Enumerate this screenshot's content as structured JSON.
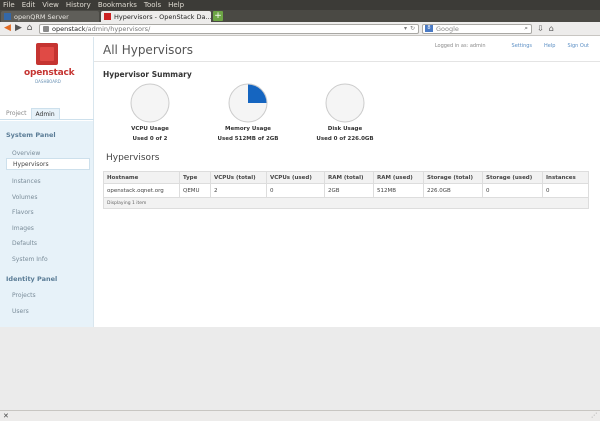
{
  "browser": {
    "menu": [
      "File",
      "Edit",
      "View",
      "History",
      "Bookmarks",
      "Tools",
      "Help"
    ],
    "tabs": [
      {
        "title": "openQRM Server",
        "active": false
      },
      {
        "title": "Hypervisors - OpenStack Da...",
        "active": true
      }
    ],
    "newtab_label": "+",
    "url_host": "openstack",
    "url_path": "/admin/hypervisors/",
    "search_placeholder": "Google",
    "search_engine_badge": "8"
  },
  "sidebar": {
    "brand": "openstack",
    "brand_sub": "DASHBOARD",
    "tabs": [
      {
        "label": "Project",
        "active": false
      },
      {
        "label": "Admin",
        "active": true
      }
    ],
    "system_panel_title": "System Panel",
    "system_items": [
      {
        "label": "Overview",
        "selected": false
      },
      {
        "label": "Hypervisors",
        "selected": true
      },
      {
        "label": "Instances",
        "selected": false
      },
      {
        "label": "Volumes",
        "selected": false
      },
      {
        "label": "Flavors",
        "selected": false
      },
      {
        "label": "Images",
        "selected": false
      },
      {
        "label": "Defaults",
        "selected": false
      },
      {
        "label": "System Info",
        "selected": false
      }
    ],
    "identity_panel_title": "Identity Panel",
    "identity_items": [
      {
        "label": "Projects"
      },
      {
        "label": "Users"
      }
    ]
  },
  "header": {
    "title": "All Hypervisors",
    "logged_in": "Logged in as: admin",
    "links": [
      "Settings",
      "Help",
      "Sign Out"
    ]
  },
  "summary": {
    "title": "Hypervisor Summary",
    "pies": [
      {
        "label": "VCPU Usage",
        "detail": "Used 0 of 2",
        "fraction": 0.0
      },
      {
        "label": "Memory Usage",
        "detail": "Used 512MB of 2GB",
        "fraction": 0.25
      },
      {
        "label": "Disk Usage",
        "detail": "Used 0 of 226.0GB",
        "fraction": 0.0
      }
    ],
    "colors": {
      "used": "#1565c0",
      "free": "#f5f5f5",
      "stroke": "#cccccc"
    }
  },
  "hypervisors": {
    "title": "Hypervisors",
    "columns": [
      "Hostname",
      "Type",
      "VCPUs (total)",
      "VCPUs (used)",
      "RAM (total)",
      "RAM (used)",
      "Storage (total)",
      "Storage (used)",
      "Instances"
    ],
    "rows": [
      [
        "openstack.oqnet.org",
        "QEMU",
        "2",
        "0",
        "2GB",
        "512MB",
        "226.0GB",
        "0",
        "0"
      ]
    ],
    "footer": "Displaying 1 item"
  }
}
